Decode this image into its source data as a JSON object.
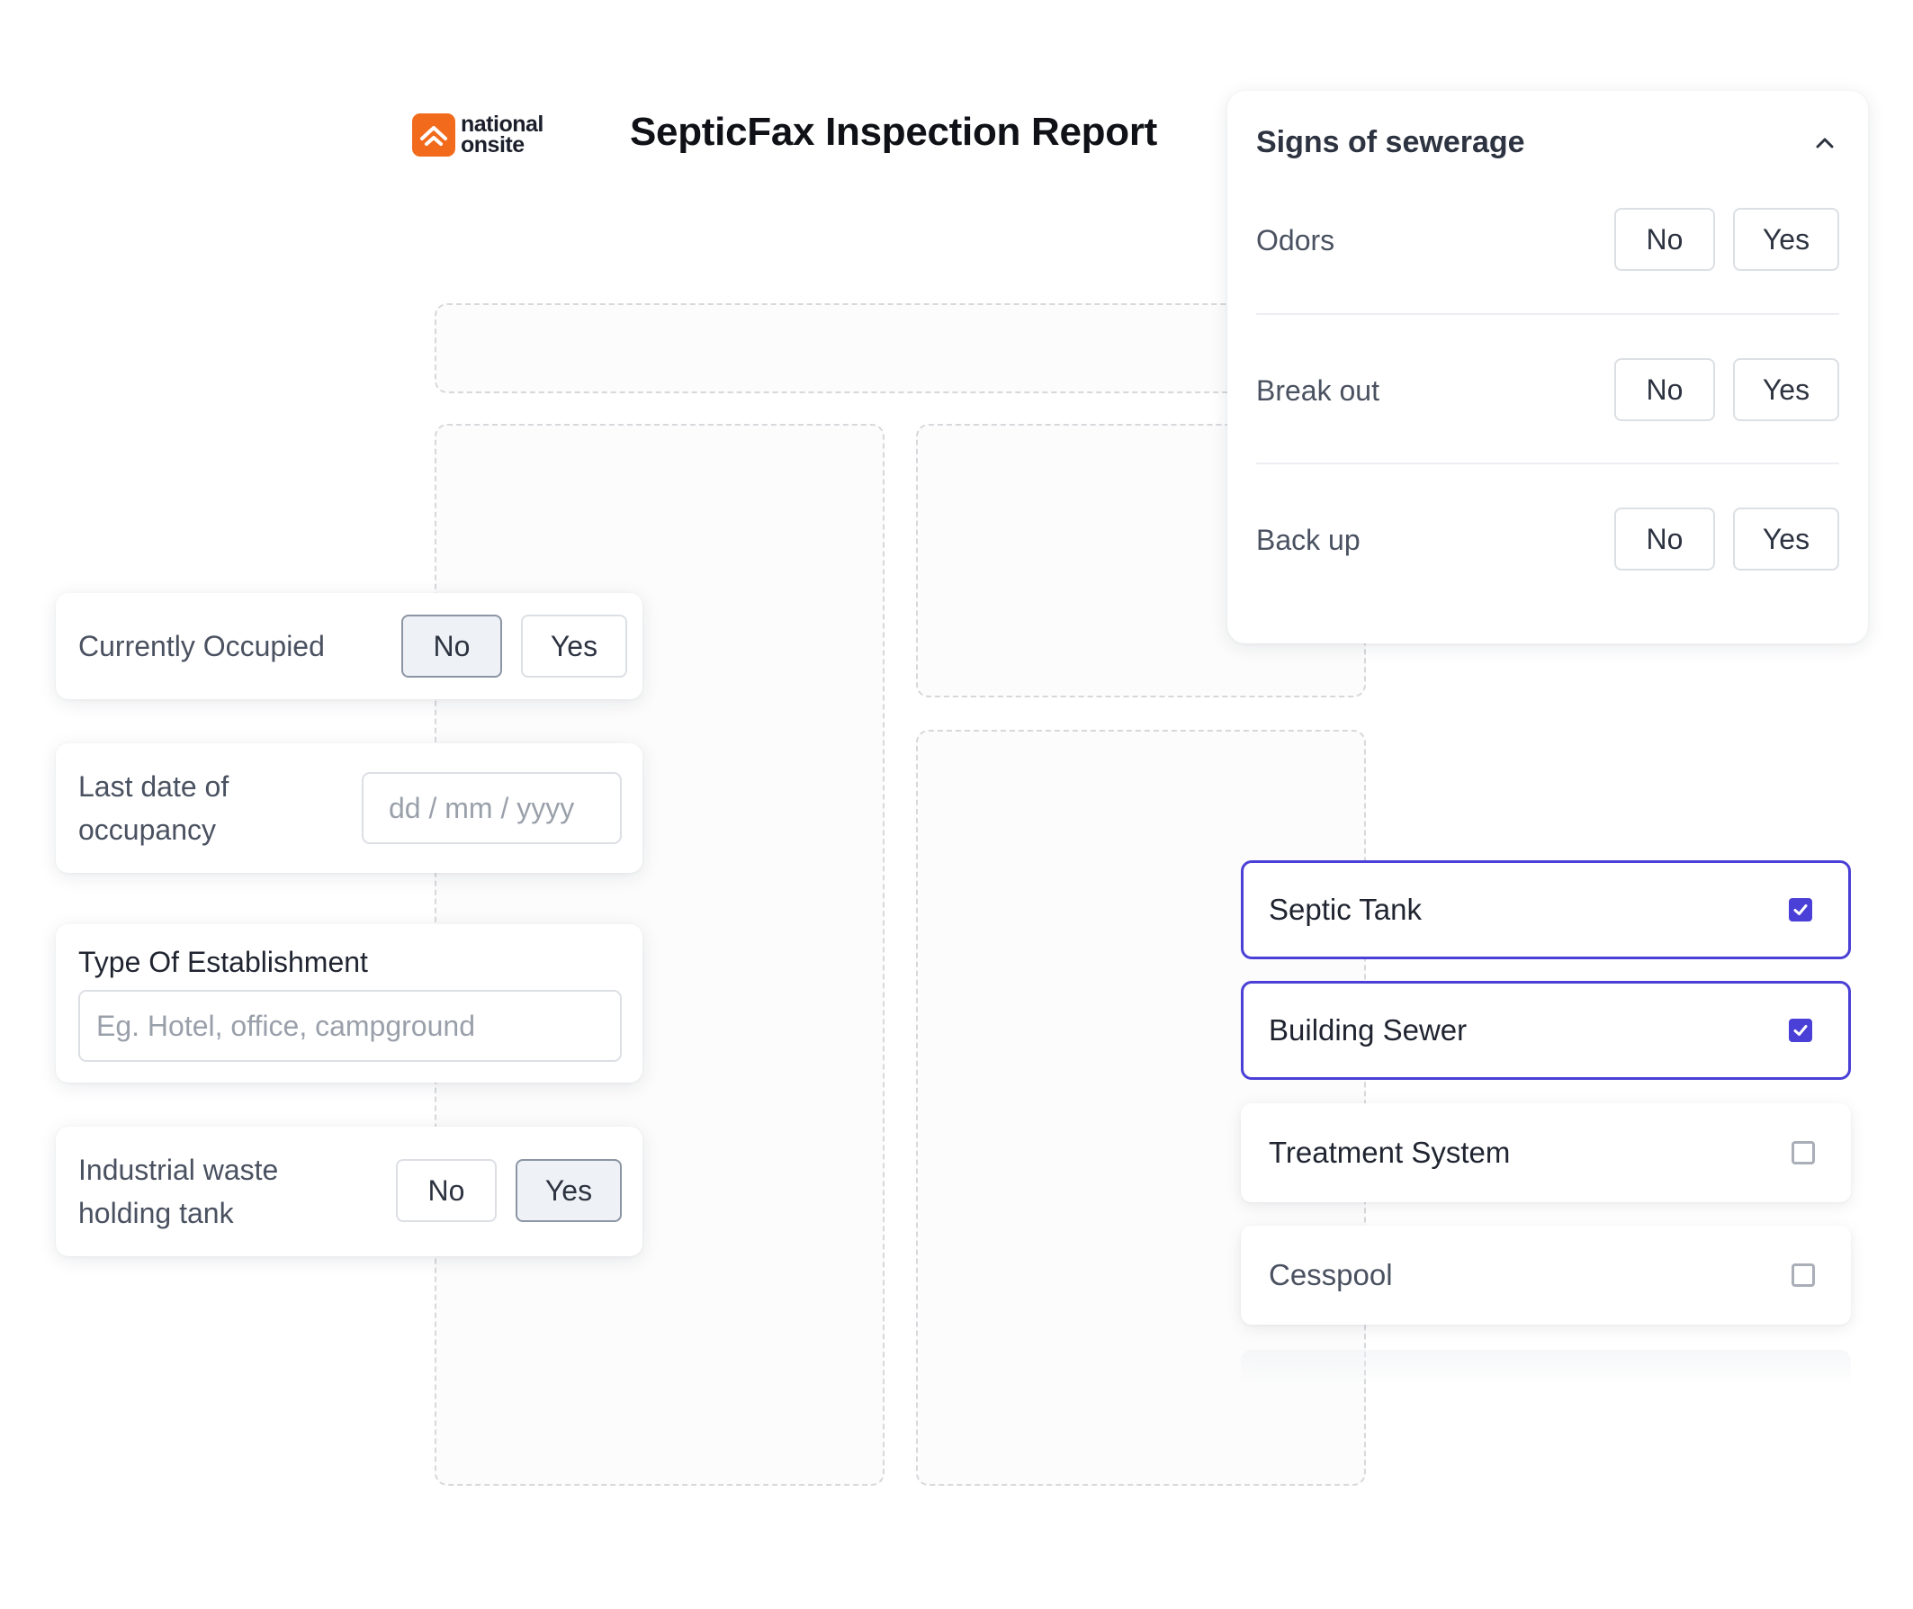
{
  "header": {
    "logo_text_line1": "national",
    "logo_text_line2": "onsite",
    "title": "SepticFax Inspection Report"
  },
  "left_cards": {
    "occupied": {
      "label": "Currently Occupied",
      "no": "No",
      "yes": "Yes",
      "selected": "No"
    },
    "last_date": {
      "label_line1": "Last date of",
      "label_line2": "occupancy",
      "placeholder": "dd / mm / yyyy"
    },
    "establishment": {
      "label": "Type Of Establishment",
      "placeholder": "Eg. Hotel, office, campground"
    },
    "industrial": {
      "label_line1": "Industrial waste",
      "label_line2": "holding tank",
      "no": "No",
      "yes": "Yes",
      "selected": "Yes"
    }
  },
  "sewerage_panel": {
    "title": "Signs of sewerage",
    "rows": [
      {
        "label": "Odors",
        "no": "No",
        "yes": "Yes"
      },
      {
        "label": "Break out",
        "no": "No",
        "yes": "Yes"
      },
      {
        "label": "Back up",
        "no": "No",
        "yes": "Yes"
      }
    ]
  },
  "system_types": [
    {
      "label": "Septic Tank",
      "checked": true
    },
    {
      "label": "Building Sewer",
      "checked": true
    },
    {
      "label": "Treatment System",
      "checked": false
    },
    {
      "label": "Cesspool",
      "checked": false
    }
  ],
  "colors": {
    "brand_orange": "#f26a1b",
    "accent_purple": "#4a3fd6",
    "selected_bg": "#eef2f6"
  }
}
